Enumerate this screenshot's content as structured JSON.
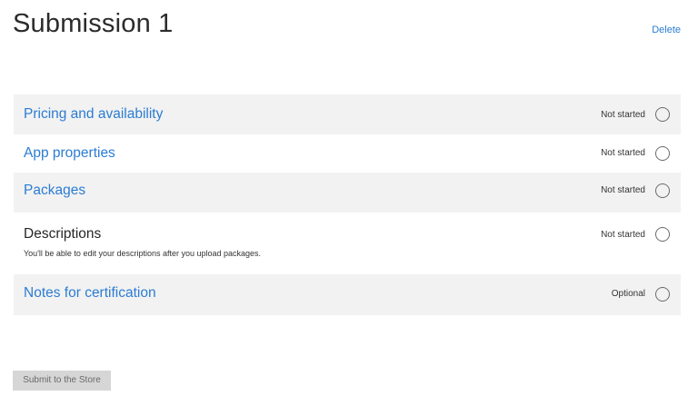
{
  "page": {
    "title": "Submission 1",
    "delete_label": "Delete"
  },
  "steps": [
    {
      "title": "Pricing and availability",
      "status": "Not started",
      "subtitle": ""
    },
    {
      "title": "App properties",
      "status": "Not started",
      "subtitle": ""
    },
    {
      "title": "Packages",
      "status": "Not started",
      "subtitle": ""
    },
    {
      "title": "Descriptions",
      "status": "Not started",
      "subtitle": "You'll be able to edit your descriptions after you upload packages."
    },
    {
      "title": "Notes for certification",
      "status": "Optional",
      "subtitle": ""
    }
  ],
  "footer": {
    "submit_label": "Submit to the Store"
  },
  "colors": {
    "link": "#2b7cd3",
    "row_shade": "#f2f2f2",
    "button_disabled": "#d6d6d6"
  }
}
